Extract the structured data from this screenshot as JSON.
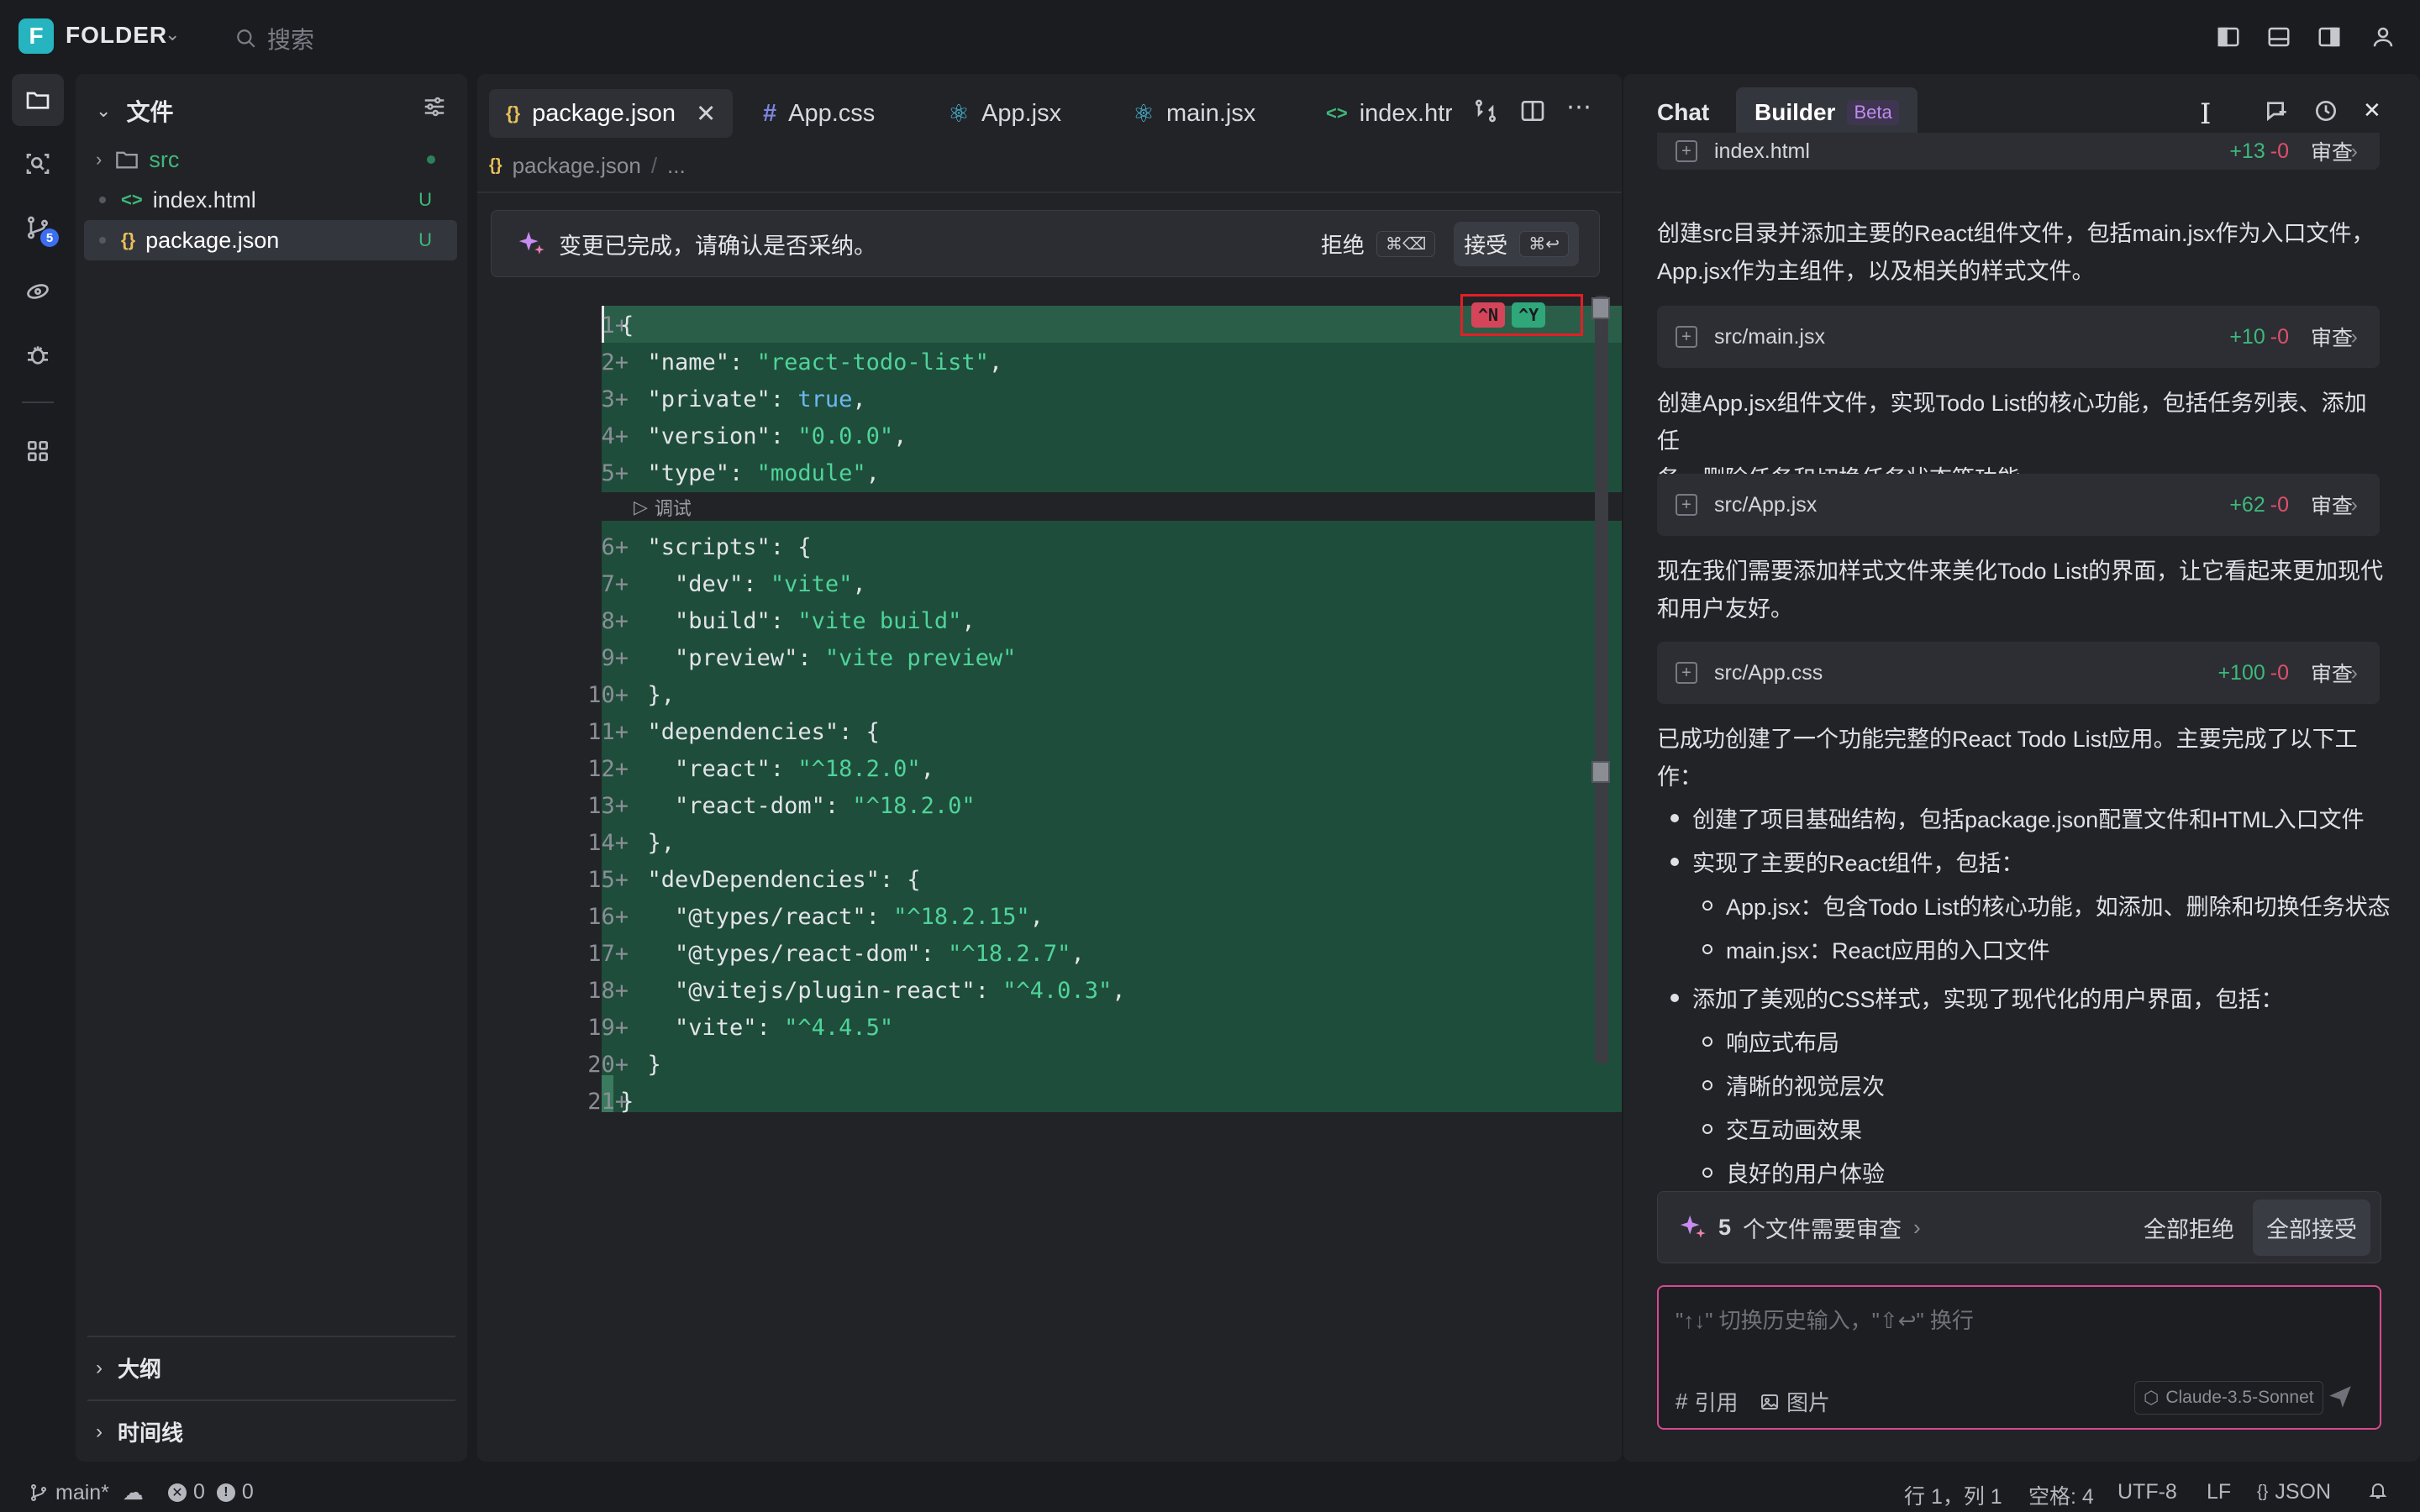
{
  "titlebar": {
    "logo_letter": "F",
    "project_name": "FOLDER",
    "search_placeholder": "搜索"
  },
  "activity": {
    "scm_badge": "5"
  },
  "explorer": {
    "title": "文件",
    "items": [
      {
        "name": "src",
        "type": "folder",
        "status": ""
      },
      {
        "name": "index.html",
        "type": "html",
        "status": "U"
      },
      {
        "name": "package.json",
        "type": "json",
        "status": "U"
      }
    ],
    "outline_label": "大纲",
    "timeline_label": "时间线"
  },
  "editor": {
    "tabs": [
      {
        "label": "package.json",
        "icon": "json-icon"
      },
      {
        "label": "App.css",
        "icon": "hash-icon"
      },
      {
        "label": "App.jsx",
        "icon": "react-icon"
      },
      {
        "label": "main.jsx",
        "icon": "react-icon"
      },
      {
        "label": "index.htr",
        "icon": "html-icon"
      }
    ],
    "breadcrumb": {
      "file": "package.json",
      "sep": "/",
      "more": "..."
    },
    "banner": {
      "message": "变更已完成，请确认是否采纳。",
      "reject_label": "拒绝",
      "reject_kbd": "⌘⌫",
      "accept_label": "接受",
      "accept_kbd": "⌘↩"
    },
    "inline_reject": "^N",
    "inline_accept": "^Y",
    "codelens": "调试",
    "lines": [
      {
        "n": "1+",
        "code": "{"
      },
      {
        "n": "2+",
        "code": "  \"name\": \"react-todo-list\","
      },
      {
        "n": "3+",
        "code": "  \"private\": true,"
      },
      {
        "n": "4+",
        "code": "  \"version\": \"0.0.0\","
      },
      {
        "n": "5+",
        "code": "  \"type\": \"module\","
      },
      {
        "n": "6+",
        "code": "  \"scripts\": {"
      },
      {
        "n": "7+",
        "code": "    \"dev\": \"vite\","
      },
      {
        "n": "8+",
        "code": "    \"build\": \"vite build\","
      },
      {
        "n": "9+",
        "code": "    \"preview\": \"vite preview\""
      },
      {
        "n": "10+",
        "code": "  },"
      },
      {
        "n": "11+",
        "code": "  \"dependencies\": {"
      },
      {
        "n": "12+",
        "code": "    \"react\": \"^18.2.0\","
      },
      {
        "n": "13+",
        "code": "    \"react-dom\": \"^18.2.0\""
      },
      {
        "n": "14+",
        "code": "  },"
      },
      {
        "n": "15+",
        "code": "  \"devDependencies\": {"
      },
      {
        "n": "16+",
        "code": "    \"@types/react\": \"^18.2.15\","
      },
      {
        "n": "17+",
        "code": "    \"@types/react-dom\": \"^18.2.7\","
      },
      {
        "n": "18+",
        "code": "    \"@vitejs/plugin-react\": \"^4.0.3\","
      },
      {
        "n": "19+",
        "code": "    \"vite\": \"^4.4.5\""
      },
      {
        "n": "20+",
        "code": "  }"
      },
      {
        "n": "21+",
        "code": "}"
      }
    ]
  },
  "chat": {
    "tab_chat": "Chat",
    "tab_builder": "Builder",
    "beta": "Beta",
    "review_label": "审查",
    "files": [
      {
        "path": "index.html",
        "add": "+13",
        "del": "-0"
      },
      {
        "path": "src/main.jsx",
        "add": "+10",
        "del": "-0"
      },
      {
        "path": "src/App.jsx",
        "add": "+62",
        "del": "-0"
      },
      {
        "path": "src/App.css",
        "add": "+100",
        "del": "-0"
      }
    ],
    "para1a": "创建src目录并添加主要的React组件文件，包括main.jsx作为入口文件，",
    "para1b": "App.jsx作为主组件，以及相关的样式文件。",
    "para2a": "创建App.jsx组件文件，实现Todo List的核心功能，包括任务列表、添加任",
    "para2b": "务、删除任务和切换任务状态等功能。",
    "para3a": "现在我们需要添加样式文件来美化Todo List的界面，让它看起来更加现代",
    "para3b": "和用户友好。",
    "para4a": "已成功创建了一个功能完整的React Todo List应用。主要完成了以下工",
    "para4b": "作：",
    "bullets": {
      "b1": "创建了项目基础结构，包括package.json配置文件和HTML入口文件",
      "b2": "实现了主要的React组件，包括：",
      "b2a": "App.jsx：包含Todo List的核心功能，如添加、删除和切换任务状态",
      "b2b": "main.jsx：React应用的入口文件",
      "b3": "添加了美观的CSS样式，实现了现代化的用户界面，包括：",
      "b3a": "响应式布局",
      "b3b": "清晰的视觉层次",
      "b3c": "交互动画效果",
      "b3d": "良好的用户体验"
    },
    "review_bar": {
      "count": "5",
      "text": "个文件需要审查",
      "reject_all": "全部拒绝",
      "accept_all": "全部接受"
    },
    "input": {
      "placeholder": "\"↑↓\" 切换历史输入，\"⇧↩\" 换行",
      "ref_label": "引用",
      "image_label": "图片",
      "model": "Claude-3.5-Sonnet"
    }
  },
  "status": {
    "branch": "main*",
    "errors": "0",
    "warnings": "0",
    "position": "行 1，列 1",
    "spaces": "空格: 4",
    "encoding": "UTF-8",
    "eol": "LF",
    "language": "JSON"
  },
  "colors": {
    "accent": "#26b5c0",
    "diff_bg": "#1f4d3b",
    "string": "#4fd49a",
    "keyword": "#6cb8f0",
    "reject_red": "#e0506a",
    "accept_green": "#2fa77a"
  }
}
